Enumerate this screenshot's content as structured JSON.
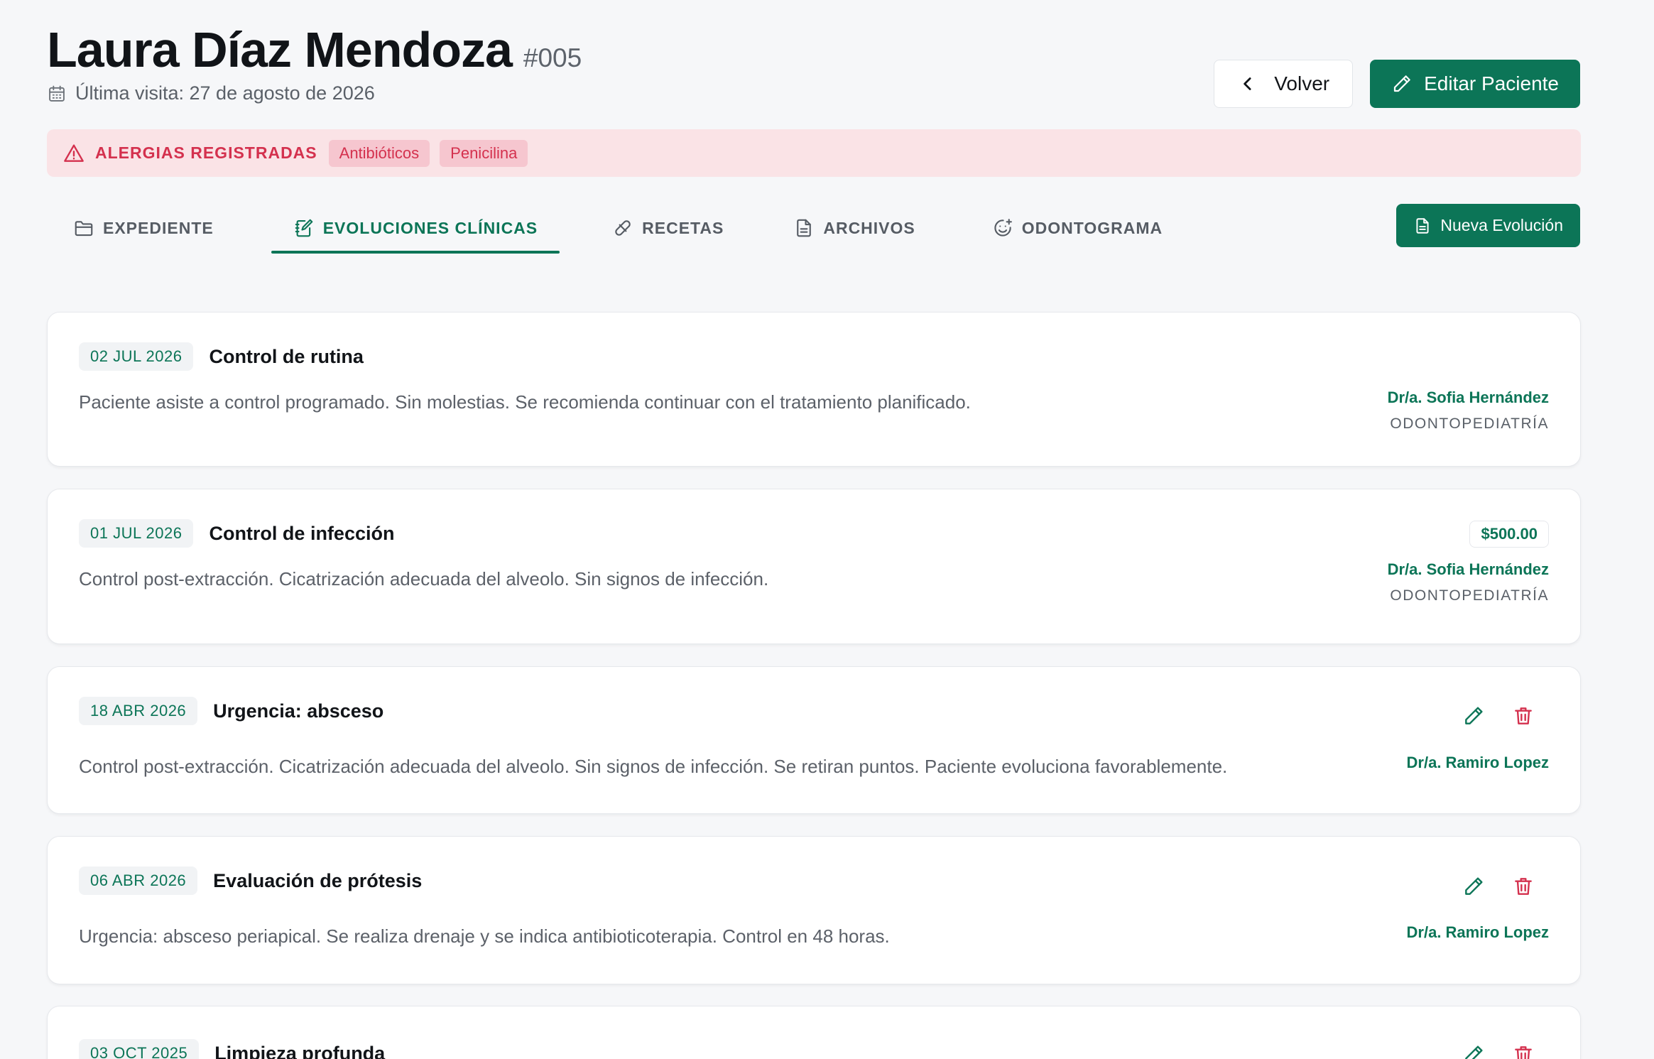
{
  "patient": {
    "name": "Laura Díaz Mendoza",
    "id": "#005",
    "last_visit": "Última visita: 27 de agosto de 2026"
  },
  "actions": {
    "back": "Volver",
    "edit": "Editar Paciente",
    "new_evolution": "Nueva Evolución"
  },
  "allergies": {
    "label": "ALERGIAS REGISTRADAS",
    "items": [
      "Antibióticos",
      "Penicilina"
    ]
  },
  "tabs": [
    {
      "label": "EXPEDIENTE",
      "icon": "folder-icon"
    },
    {
      "label": "EVOLUCIONES CLÍNICAS",
      "icon": "notebook-edit-icon",
      "active": true
    },
    {
      "label": "RECETAS",
      "icon": "pill-icon"
    },
    {
      "label": "ARCHIVOS",
      "icon": "file-icon"
    },
    {
      "label": "ODONTOGRAMA",
      "icon": "smile-plus-icon"
    }
  ],
  "evolutions": [
    {
      "date": "02 JUL 2026",
      "title": "Control de rutina",
      "description": "Paciente asiste a control programado. Sin molestias. Se recomienda continuar con el tratamiento planificado.",
      "doctor": "Dr/a. Sofia Hernández",
      "specialty": "ODONTOPEDIATRÍA"
    },
    {
      "date": "01 JUL 2026",
      "title": "Control de infección",
      "description": "Control post-extracción. Cicatrización adecuada del alveolo. Sin signos de infección.",
      "doctor": "Dr/a. Sofia Hernández",
      "specialty": "ODONTOPEDIATRÍA",
      "price": "$500.00"
    },
    {
      "date": "18 ABR 2026",
      "title": "Urgencia: absceso",
      "description": "Control post-extracción. Cicatrización adecuada del alveolo. Sin signos de infección. Se retiran puntos. Paciente evoluciona favorablemente.",
      "doctor": "Dr/a. Ramiro Lopez"
    },
    {
      "date": "06 ABR 2026",
      "title": "Evaluación de prótesis",
      "description": "Urgencia: absceso periapical. Se realiza drenaje y se indica antibioticoterapia. Control en 48 horas.",
      "doctor": "Dr/a. Ramiro Lopez"
    },
    {
      "date": "03 OCT 2025",
      "title": "Limpieza profunda"
    }
  ],
  "colors": {
    "primary": "#0c7557",
    "danger": "#d4314e",
    "allergy_bg": "#fae3e6"
  }
}
